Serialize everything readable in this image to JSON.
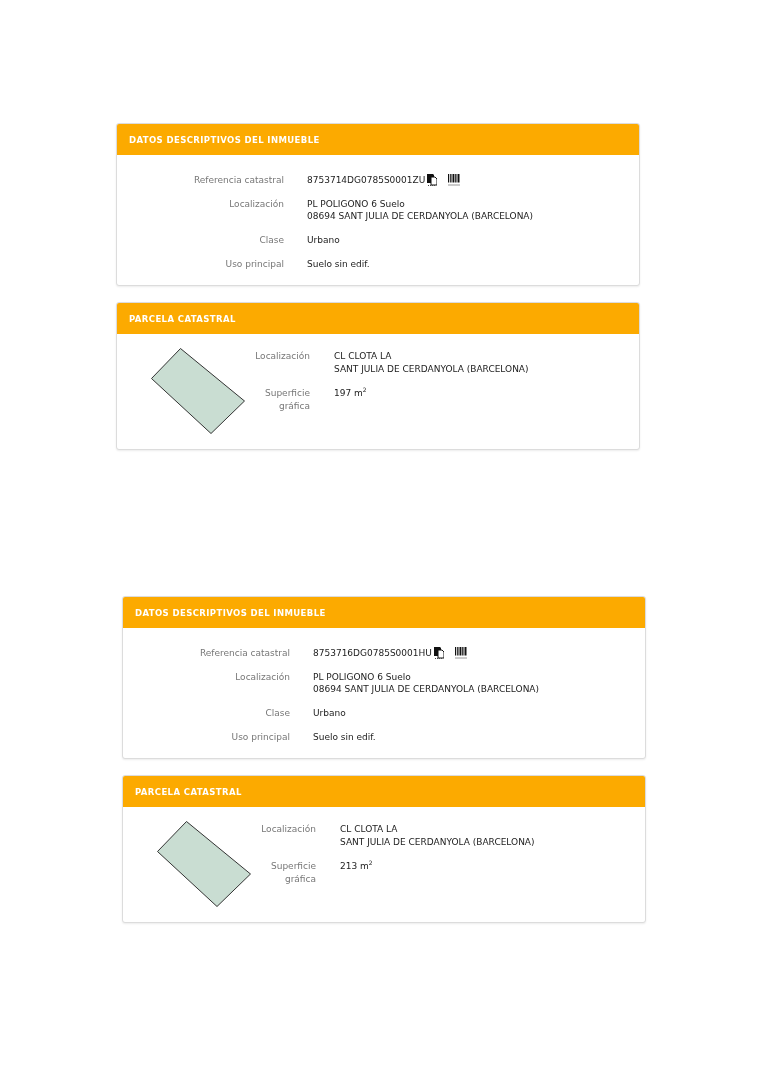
{
  "documents": [
    {
      "property_data": {
        "title": "DATOS DESCRIPTIVOS DEL INMUEBLE",
        "fields": [
          {
            "kind": "reference",
            "label": "Referencia catastral",
            "lines": [
              "8753714DG0785S0001ZU"
            ]
          },
          {
            "kind": "text",
            "label": "Localización",
            "lines": [
              "PL POLIGONO 6 Suelo",
              "08694 SANT JULIA DE CERDANYOLA (BARCELONA)"
            ]
          },
          {
            "kind": "text",
            "label": "Clase",
            "lines": [
              "Urbano"
            ]
          },
          {
            "kind": "text",
            "label": "Uso principal",
            "lines": [
              "Suelo sin edif."
            ]
          }
        ]
      },
      "parcel": {
        "title": "PARCELA CATASTRAL",
        "fields": [
          {
            "label": "Localización",
            "lines": [
              "CL CLOTA LA",
              "SANT JULIA DE CERDANYOLA (BARCELONA)"
            ]
          },
          {
            "label": "Superficie gráfica",
            "lines": [
              "197 m$^{2}$"
            ]
          }
        ]
      }
    },
    {
      "property_data": {
        "title": "DATOS DESCRIPTIVOS DEL INMUEBLE",
        "fields": [
          {
            "kind": "reference",
            "label": "Referencia catastral",
            "lines": [
              "8753716DG0785S0001HU"
            ]
          },
          {
            "kind": "text",
            "label": "Localización",
            "lines": [
              "PL POLIGONO 6 Suelo",
              "08694 SANT JULIA DE CERDANYOLA (BARCELONA)"
            ]
          },
          {
            "kind": "text",
            "label": "Clase",
            "lines": [
              "Urbano"
            ]
          },
          {
            "kind": "text",
            "label": "Uso principal",
            "lines": [
              "Suelo sin edif."
            ]
          }
        ]
      },
      "parcel": {
        "title": "PARCELA CATASTRAL",
        "fields": [
          {
            "label": "Localización",
            "lines": [
              "CL CLOTA LA",
              "SANT JULIA DE CERDANYOLA (BARCELONA)"
            ]
          },
          {
            "label": "Superficie gráfica",
            "lines": [
              "213 m$^{2}$"
            ]
          }
        ]
      }
    }
  ]
}
